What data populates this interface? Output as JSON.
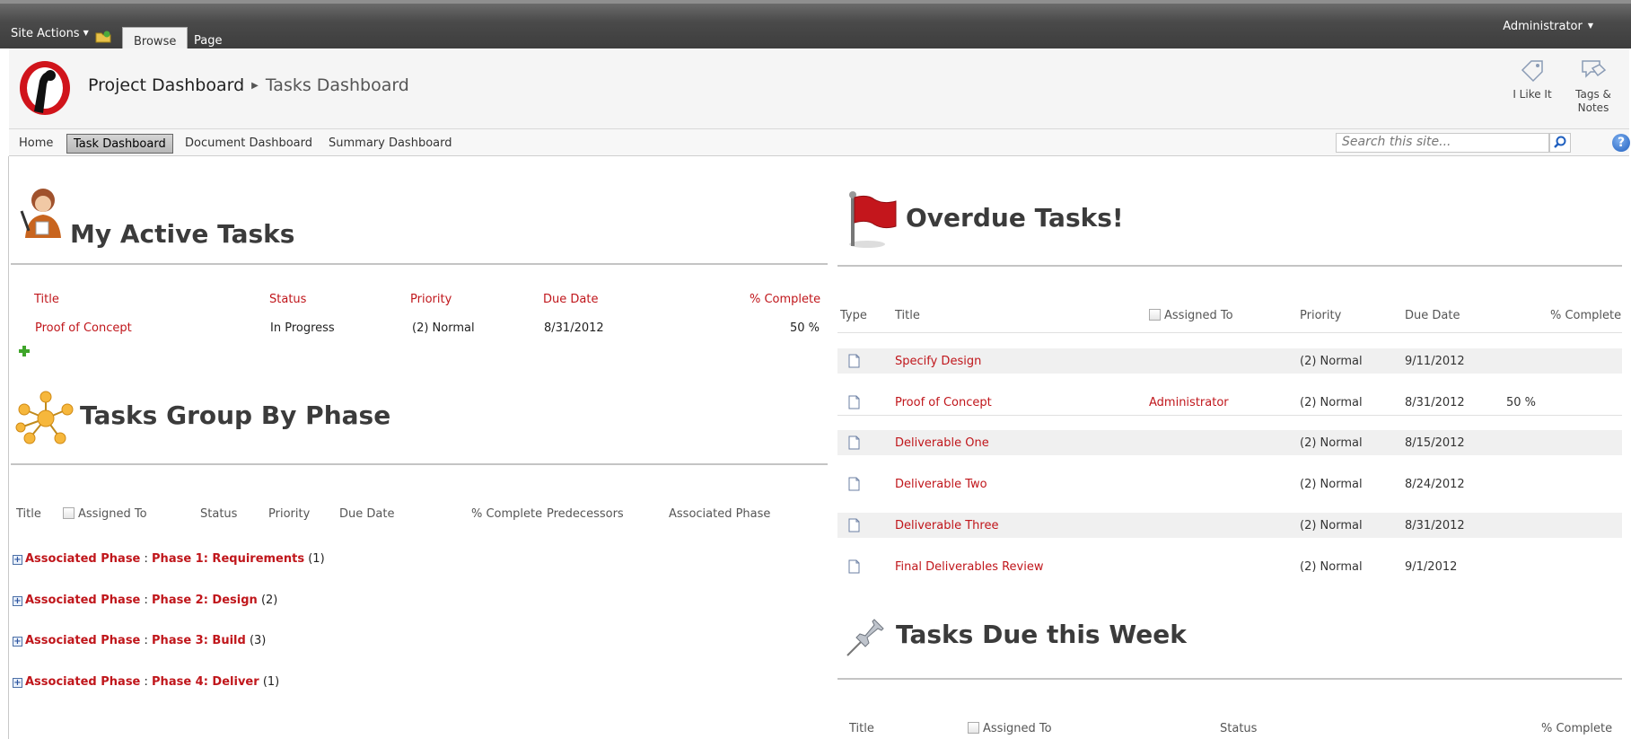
{
  "ribbon": {
    "site_actions": "Site Actions",
    "tabs": [
      "Browse",
      "Page"
    ],
    "user": "Administrator"
  },
  "header": {
    "site": "Project Dashboard",
    "page": "Tasks Dashboard",
    "like_label": "I Like It",
    "tags_label_1": "Tags &",
    "tags_label_2": "Notes"
  },
  "nav": {
    "items": [
      "Home",
      "Task Dashboard",
      "Document Dashboard",
      "Summary Dashboard"
    ],
    "active": "Task Dashboard",
    "search_placeholder": "Search this site...",
    "help": "?"
  },
  "active_tasks": {
    "title": "My Active Tasks",
    "columns": [
      "Title",
      "Status",
      "Priority",
      "Due Date",
      "% Complete"
    ],
    "rows": [
      {
        "title": "Proof of Concept",
        "status": "In Progress",
        "priority": "(2) Normal",
        "due": "8/31/2012",
        "complete": "50 %"
      }
    ]
  },
  "by_phase": {
    "title": "Tasks Group By Phase",
    "columns": [
      "Title",
      "Assigned To",
      "Status",
      "Priority",
      "Due Date",
      "% Complete",
      "Predecessors",
      "Associated Phase"
    ],
    "groups": [
      {
        "field": "Associated Phase",
        "sep": " : ",
        "value": "Phase 1: Requirements",
        "count": "(1)"
      },
      {
        "field": "Associated Phase",
        "sep": " : ",
        "value": "Phase 2: Design",
        "count": "(2)"
      },
      {
        "field": "Associated Phase",
        "sep": " : ",
        "value": "Phase 3: Build",
        "count": "(3)"
      },
      {
        "field": "Associated Phase",
        "sep": " : ",
        "value": "Phase 4: Deliver",
        "count": "(1)"
      }
    ]
  },
  "overdue": {
    "title": "Overdue Tasks!",
    "columns": [
      "Type",
      "Title",
      "Assigned To",
      "Priority",
      "Due Date",
      "% Complete"
    ],
    "rows": [
      {
        "title": "Specify Design",
        "assigned": "",
        "priority": "(2) Normal",
        "due": "9/11/2012",
        "complete": ""
      },
      {
        "title": "Proof of Concept",
        "assigned": "Administrator",
        "priority": "(2) Normal",
        "due": "8/31/2012",
        "complete": "50 %"
      },
      {
        "title": "Deliverable One",
        "assigned": "",
        "priority": "(2) Normal",
        "due": "8/15/2012",
        "complete": ""
      },
      {
        "title": "Deliverable Two",
        "assigned": "",
        "priority": "(2) Normal",
        "due": "8/24/2012",
        "complete": ""
      },
      {
        "title": "Deliverable Three",
        "assigned": "",
        "priority": "(2) Normal",
        "due": "8/31/2012",
        "complete": ""
      },
      {
        "title": "Final Deliverables Review",
        "assigned": "",
        "priority": "(2) Normal",
        "due": "9/1/2012",
        "complete": ""
      }
    ]
  },
  "due_week": {
    "title": "Tasks Due this Week",
    "columns": [
      "Title",
      "Assigned To",
      "Status",
      "% Complete"
    ]
  },
  "colors": {
    "link_red": "#c0161b",
    "ribbon": "#4a4a4a"
  }
}
